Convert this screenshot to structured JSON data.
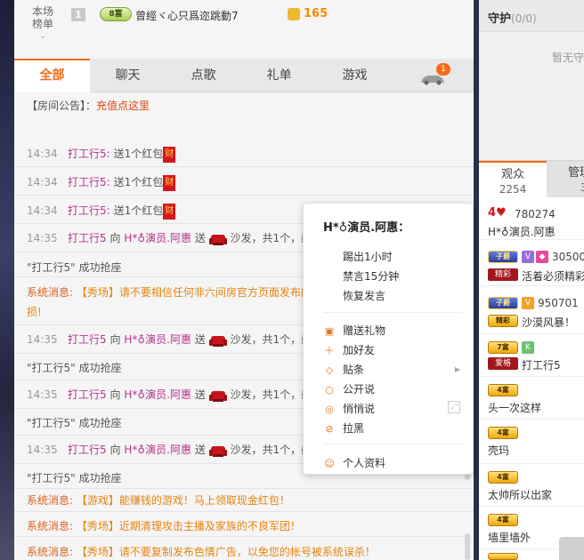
{
  "rank": {
    "label_line1": "本场",
    "label_line2": "榜单",
    "chevron": "⌄",
    "position": "1",
    "badge": "8富",
    "name": "曾經ヾ心只爲迩跳動7",
    "coin_value": "165"
  },
  "tabs": [
    {
      "label": "全部",
      "active": true
    },
    {
      "label": "聊天"
    },
    {
      "label": "点歌"
    },
    {
      "label": "礼单"
    },
    {
      "label": "游戏"
    }
  ],
  "car_badge": "1",
  "notice": {
    "prefix": "【房间公告】：",
    "link": "充值点这里"
  },
  "messages": {
    "m1": {
      "time": "14:34",
      "name": "打工行5:",
      "text": "送1个红包",
      "env": "财"
    },
    "m2": {
      "time": "14:34",
      "name": "打工行5:",
      "text": "送1个红包",
      "env": "财"
    },
    "m3": {
      "time": "14:34",
      "name": "打工行5:",
      "text": "送1个红包",
      "env": "财"
    },
    "m4": {
      "time": "14:35",
      "name": "打工行5",
      "mid": "向",
      "target": "H*♁演员.阿惠",
      "verb": "送",
      "tail": "沙发，共1个，感"
    },
    "m5": {
      "text": "\"打工行5\" 成功抢座"
    },
    "m6": {
      "tag": "系统消息:",
      "text": "【秀场】请不要相信任何非六间房官方页面发布的",
      "cont": "损!"
    },
    "m7": {
      "time": "14:35",
      "name": "打工行5",
      "mid": "向",
      "target": "H*♁演员.阿惠",
      "verb": "送",
      "tail": "沙发，共1个，感"
    },
    "m8": {
      "text": "\"打工行5\" 成功抢座"
    },
    "m9": {
      "time": "14:35",
      "name": "打工行5",
      "mid": "向",
      "target": "H*♁演员.阿惠",
      "verb": "送",
      "tail": "沙发，共1个，感"
    },
    "m10": {
      "text": "\"打工行5\" 成功抢座"
    },
    "m11": {
      "time": "14:35",
      "name": "打工行5",
      "mid": "向",
      "target": "H*♁演员.阿惠",
      "verb": "送",
      "tail": "沙发，共1个，感"
    },
    "m12": {
      "text": "\"打工行5\" 成功抢座"
    },
    "m13": {
      "tag": "系统消息:",
      "text": "【游戏】能赚钱的游戏！马上领取现金红包！"
    },
    "m14": {
      "tag": "系统消息:",
      "text": "【秀场】近期清理攻击主播及家族的不良军团！"
    },
    "m15": {
      "tag": "系统消息:",
      "text": "【秀场】请不要复制发布色情广告，以免您的帐号被系统误杀！"
    }
  },
  "popup": {
    "title": "H*♁演员.阿惠：",
    "kick": "踢出1小时",
    "mute": "禁言15分钟",
    "restore": "恢复发言",
    "gift": "赠送礼物",
    "add_friend": "加好友",
    "sticker": "贴条",
    "public_chat": "公开说",
    "whisper": "悄悄说",
    "block": "拉黑",
    "profile": "个人资料"
  },
  "right": {
    "guard_title": "守护",
    "guard_count": "(0/0)",
    "guard_empty": "暂无守",
    "tab_audience": "观众",
    "audience_count": "2254",
    "tab_manage": "管理",
    "manage_count": "3",
    "audience": {
      "a1": {
        "num": "780274",
        "name": "H*♁演员.阿惠"
      },
      "a2": {
        "badge": "子爵",
        "num": "30500",
        "tag": "精彩",
        "name": "活着必须精彩"
      },
      "a3": {
        "badge": "子爵",
        "num": "950701",
        "tag": "精彩",
        "name": "沙漠风暴！"
      },
      "a4": {
        "badge": "7富",
        "tag": "爱格",
        "name": "打工行5"
      },
      "a5": {
        "badge": "4富",
        "name": "头一次这样"
      },
      "a6": {
        "badge": "4富",
        "name": "壳玛"
      },
      "a7": {
        "badge": "4富",
        "name": "太帅所以出家"
      },
      "a8": {
        "badge": "4富",
        "name": "墙里墙外"
      }
    }
  }
}
